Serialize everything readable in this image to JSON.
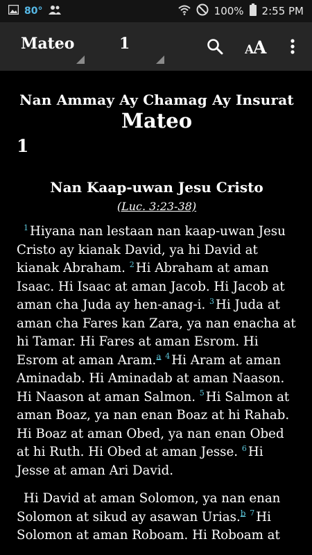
{
  "status_bar": {
    "temperature": "80°",
    "battery": "100%",
    "time": "2:55 PM"
  },
  "toolbar": {
    "book": "Mateo",
    "chapter": "1"
  },
  "content": {
    "book_header": "Nan Ammay Ay Chamag Ay Insurat",
    "book_title": "Mateo",
    "chapter_number": "1",
    "section_title": "Nan Kaap-uwan Jesu Cristo",
    "section_ref": "(Luc. 3:23-38)",
    "paragraph1": [
      {
        "v": "1",
        "text": "Hiyana nan lestaan nan kaap-uwan Jesu Cristo ay kianak David, ya hi David at kianak Abraham. "
      },
      {
        "v": "2",
        "text": "Hi Abraham at aman Isaac. Hi Isaac at aman Jacob. Hi Jacob at aman cha Juda ay hen-anag-i. "
      },
      {
        "v": "3",
        "text": "Hi Juda at aman cha Fares kan Zara, ya nan enacha at hi Tamar. Hi Fares at aman Esrom. Hi Esrom at aman Aram.",
        "fn": "a"
      },
      {
        "v": "4",
        "text": "Hi Aram at aman Aminadab. Hi Aminadab at aman Naason. Hi Naason at aman Salmon. "
      },
      {
        "v": "5",
        "text": "Hi Salmon at aman Boaz, ya nan enan Boaz at hi Rahab. Hi Boaz at aman Obed, ya nan enan Obed at hi Ruth. Hi Obed at aman Jesse. "
      },
      {
        "v": "6",
        "text": "Hi Jesse at aman Ari David."
      }
    ],
    "paragraph2": [
      {
        "v": "",
        "text": "Hi David at aman Solomon, ya nan enan Solomon at sikud ay asawan Urias.",
        "fn": "b"
      },
      {
        "v": "7",
        "text": "Hi Solomon at aman Roboam. Hi Roboam at"
      }
    ]
  }
}
